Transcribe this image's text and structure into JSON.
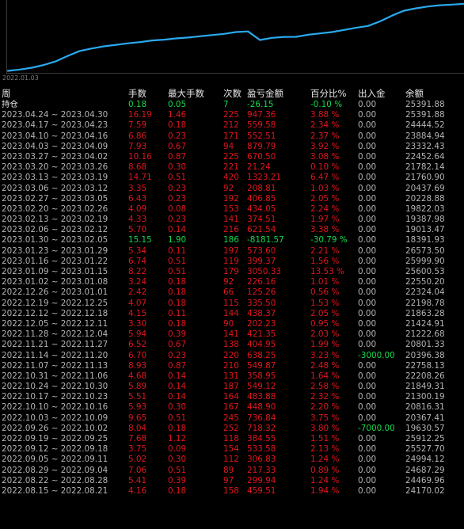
{
  "colors": {
    "background": "#000000",
    "line": "#2aa9ee",
    "neutral": "#b4b4b4",
    "header": "#e8e8e8",
    "positive": "#16d84a",
    "negative": "#e0161c"
  },
  "chart": {
    "date_label": "2022.01.03"
  },
  "chart_data": {
    "type": "line",
    "x_tick_labels": [
      "2022.01.03"
    ],
    "series": [
      {
        "color": "#2aa9ee",
        "values": [
          10830,
          11050,
          11340,
          11800,
          12400,
          13300,
          14100,
          14500,
          14850,
          15100,
          15350,
          15550,
          15820,
          15950,
          16150,
          16300,
          16500,
          16700,
          16900,
          17200,
          17300,
          15900,
          16250,
          16400,
          16420,
          16750,
          16980,
          17200,
          17550,
          17900,
          18200,
          18950,
          19900,
          20700,
          21100,
          21400,
          21600,
          21700,
          21840
        ]
      }
    ]
  },
  "table": {
    "headers": [
      "周",
      "手数",
      "最大手数",
      "次数",
      "盈亏金额",
      "百分比%",
      "出入金",
      "余额"
    ],
    "holding": {
      "label": "持仓",
      "lots": "0.18",
      "max_lots": "0.05",
      "count": "7",
      "pnl": "-26.15",
      "pct": "-0.10 %",
      "inout": "0.00",
      "balance": "25391.88"
    },
    "rows": [
      {
        "week": "2023.04.24 ~ 2023.04.30",
        "lots": "16.19",
        "max_lots": "1.46",
        "count": "225",
        "pnl": "947.36",
        "pct": "3.88 %",
        "inout": "0.00",
        "balance": "25391.88"
      },
      {
        "week": "2023.04.17 ~ 2023.04.23",
        "lots": "7.59",
        "max_lots": "0.18",
        "count": "212",
        "pnl": "559.58",
        "pct": "2.34 %",
        "inout": "0.00",
        "balance": "24444.52"
      },
      {
        "week": "2023.04.10 ~ 2023.04.16",
        "lots": "6.86",
        "max_lots": "0.23",
        "count": "171",
        "pnl": "552.51",
        "pct": "2.37 %",
        "inout": "0.00",
        "balance": "23884.94"
      },
      {
        "week": "2023.04.03 ~ 2023.04.09",
        "lots": "7.93",
        "max_lots": "0.67",
        "count": "94",
        "pnl": "879.79",
        "pct": "3.92 %",
        "inout": "0.00",
        "balance": "23332.43"
      },
      {
        "week": "2023.03.27 ~ 2023.04.02",
        "lots": "10.16",
        "max_lots": "0.87",
        "count": "225",
        "pnl": "670.50",
        "pct": "3.08 %",
        "inout": "0.00",
        "balance": "22452.64"
      },
      {
        "week": "2023.03.20 ~ 2023.03.26",
        "lots": "8.68",
        "max_lots": "0.30",
        "count": "221",
        "pnl": "21.24",
        "pct": "0.10 %",
        "inout": "0.00",
        "balance": "21782.14"
      },
      {
        "week": "2023.03.13 ~ 2023.03.19",
        "lots": "14.71",
        "max_lots": "0.51",
        "count": "420",
        "pnl": "1323.21",
        "pct": "6.47 %",
        "inout": "0.00",
        "balance": "21760.90"
      },
      {
        "week": "2023.03.06 ~ 2023.03.12",
        "lots": "3.35",
        "max_lots": "0.23",
        "count": "92",
        "pnl": "208.81",
        "pct": "1.03 %",
        "inout": "0.00",
        "balance": "20437.69"
      },
      {
        "week": "2023.02.27 ~ 2023.03.05",
        "lots": "6.43",
        "max_lots": "0.23",
        "count": "192",
        "pnl": "406.85",
        "pct": "2.05 %",
        "inout": "0.00",
        "balance": "20228.88"
      },
      {
        "week": "2023.02.20 ~ 2023.02.26",
        "lots": "4.09",
        "max_lots": "0.08",
        "count": "153",
        "pnl": "434.05",
        "pct": "2.24 %",
        "inout": "0.00",
        "balance": "19822.03"
      },
      {
        "week": "2023.02.13 ~ 2023.02.19",
        "lots": "4.33",
        "max_lots": "0.23",
        "count": "141",
        "pnl": "374.51",
        "pct": "1.97 %",
        "inout": "0.00",
        "balance": "19387.98"
      },
      {
        "week": "2023.02.06 ~ 2023.02.12",
        "lots": "5.70",
        "max_lots": "0.14",
        "count": "216",
        "pnl": "621.54",
        "pct": "3.38 %",
        "inout": "0.00",
        "balance": "19013.47"
      },
      {
        "week": "2023.01.30 ~ 2023.02.05",
        "lots": "15.15",
        "max_lots": "1.90",
        "count": "186",
        "pnl": "-8181.57",
        "pct": "-30.79 %",
        "inout": "0.00",
        "balance": "18391.93"
      },
      {
        "week": "2023.01.23 ~ 2023.01.29",
        "lots": "5.34",
        "max_lots": "0.11",
        "count": "197",
        "pnl": "573.60",
        "pct": "2.21 %",
        "inout": "0.00",
        "balance": "26573.50"
      },
      {
        "week": "2023.01.16 ~ 2023.01.22",
        "lots": "6.74",
        "max_lots": "0.51",
        "count": "119",
        "pnl": "399.37",
        "pct": "1.56 %",
        "inout": "0.00",
        "balance": "25999.90"
      },
      {
        "week": "2023.01.09 ~ 2023.01.15",
        "lots": "8.22",
        "max_lots": "0.51",
        "count": "179",
        "pnl": "3050.33",
        "pct": "13.53 %",
        "inout": "0.00",
        "balance": "25600.53"
      },
      {
        "week": "2023.01.02 ~ 2023.01.08",
        "lots": "3.24",
        "max_lots": "0.18",
        "count": "92",
        "pnl": "226.16",
        "pct": "1.01 %",
        "inout": "0.00",
        "balance": "22550.20"
      },
      {
        "week": "2022.12.26 ~ 2023.01.01",
        "lots": "2.42",
        "max_lots": "0.18",
        "count": "66",
        "pnl": "125.26",
        "pct": "0.56 %",
        "inout": "0.00",
        "balance": "22324.04"
      },
      {
        "week": "2022.12.19 ~ 2022.12.25",
        "lots": "4.07",
        "max_lots": "0.18",
        "count": "115",
        "pnl": "335.50",
        "pct": "1.53 %",
        "inout": "0.00",
        "balance": "22198.78"
      },
      {
        "week": "2022.12.12 ~ 2022.12.18",
        "lots": "4.15",
        "max_lots": "0.11",
        "count": "144",
        "pnl": "438.37",
        "pct": "2.05 %",
        "inout": "0.00",
        "balance": "21863.28"
      },
      {
        "week": "2022.12.05 ~ 2022.12.11",
        "lots": "3.30",
        "max_lots": "0.18",
        "count": "90",
        "pnl": "202.23",
        "pct": "0.95 %",
        "inout": "0.00",
        "balance": "21424.91"
      },
      {
        "week": "2022.11.28 ~ 2022.12.04",
        "lots": "5.94",
        "max_lots": "0.39",
        "count": "141",
        "pnl": "421.35",
        "pct": "2.03 %",
        "inout": "0.00",
        "balance": "21222.68"
      },
      {
        "week": "2022.11.21 ~ 2022.11.27",
        "lots": "6.52",
        "max_lots": "0.67",
        "count": "138",
        "pnl": "404.95",
        "pct": "1.99 %",
        "inout": "0.00",
        "balance": "20801.33"
      },
      {
        "week": "2022.11.14 ~ 2022.11.20",
        "lots": "6.70",
        "max_lots": "0.23",
        "count": "220",
        "pnl": "638.25",
        "pct": "3.23 %",
        "inout": "-3000.00",
        "balance": "20396.38"
      },
      {
        "week": "2022.11.07 ~ 2022.11.13",
        "lots": "8.93",
        "max_lots": "0.87",
        "count": "210",
        "pnl": "549.87",
        "pct": "2.48 %",
        "inout": "0.00",
        "balance": "22758.13"
      },
      {
        "week": "2022.10.31 ~ 2022.11.06",
        "lots": "4.68",
        "max_lots": "0.14",
        "count": "131",
        "pnl": "358.95",
        "pct": "1.64 %",
        "inout": "0.00",
        "balance": "22208.26"
      },
      {
        "week": "2022.10.24 ~ 2022.10.30",
        "lots": "5.89",
        "max_lots": "0.14",
        "count": "187",
        "pnl": "549.12",
        "pct": "2.58 %",
        "inout": "0.00",
        "balance": "21849.31"
      },
      {
        "week": "2022.10.17 ~ 2022.10.23",
        "lots": "5.51",
        "max_lots": "0.14",
        "count": "164",
        "pnl": "483.88",
        "pct": "2.32 %",
        "inout": "0.00",
        "balance": "21300.19"
      },
      {
        "week": "2022.10.10 ~ 2022.10.16",
        "lots": "5.93",
        "max_lots": "0.30",
        "count": "167",
        "pnl": "448.90",
        "pct": "2.20 %",
        "inout": "0.00",
        "balance": "20816.31"
      },
      {
        "week": "2022.10.03 ~ 2022.10.09",
        "lots": "9.65",
        "max_lots": "0.51",
        "count": "245",
        "pnl": "736.84",
        "pct": "3.75 %",
        "inout": "0.00",
        "balance": "20367.41"
      },
      {
        "week": "2022.09.26 ~ 2022.10.02",
        "lots": "8.04",
        "max_lots": "0.18",
        "count": "252",
        "pnl": "718.32",
        "pct": "3.80 %",
        "inout": "-7000.00",
        "balance": "19630.57"
      },
      {
        "week": "2022.09.19 ~ 2022.09.25",
        "lots": "7.68",
        "max_lots": "1.12",
        "count": "118",
        "pnl": "384.55",
        "pct": "1.51 %",
        "inout": "0.00",
        "balance": "25912.25"
      },
      {
        "week": "2022.09.12 ~ 2022.09.18",
        "lots": "3.75",
        "max_lots": "0.09",
        "count": "154",
        "pnl": "533.58",
        "pct": "2.13 %",
        "inout": "0.00",
        "balance": "25527.70"
      },
      {
        "week": "2022.09.05 ~ 2022.09.11",
        "lots": "5.02",
        "max_lots": "0.30",
        "count": "112",
        "pnl": "306.83",
        "pct": "1.24 %",
        "inout": "0.00",
        "balance": "24994.12"
      },
      {
        "week": "2022.08.29 ~ 2022.09.04",
        "lots": "7.06",
        "max_lots": "0.51",
        "count": "89",
        "pnl": "217.33",
        "pct": "0.89 %",
        "inout": "0.00",
        "balance": "24687.29"
      },
      {
        "week": "2022.08.22 ~ 2022.08.28",
        "lots": "5.41",
        "max_lots": "0.39",
        "count": "97",
        "pnl": "299.94",
        "pct": "1.24 %",
        "inout": "0.00",
        "balance": "24469.96"
      },
      {
        "week": "2022.08.15 ~ 2022.08.21",
        "lots": "4.16",
        "max_lots": "0.18",
        "count": "158",
        "pnl": "459.51",
        "pct": "1.94 %",
        "inout": "0.00",
        "balance": "24170.02"
      }
    ]
  }
}
